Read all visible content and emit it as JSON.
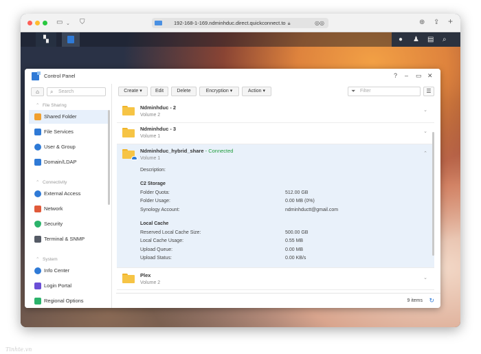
{
  "browser": {
    "url": "192-168-1-169.ndminhduc.direct.quickconnect.to"
  },
  "window": {
    "title": "Control Panel"
  },
  "sidebar": {
    "search_placeholder": "Search",
    "sections": [
      {
        "title": "File Sharing",
        "items": [
          {
            "label": "Shared Folder",
            "icon": "shared-folder-icon",
            "color": "#f0a030",
            "active": true
          },
          {
            "label": "File Services",
            "icon": "file-services-icon",
            "color": "#2f7ad6"
          },
          {
            "label": "User & Group",
            "icon": "user-group-icon",
            "color": "#2f7ad6"
          },
          {
            "label": "Domain/LDAP",
            "icon": "domain-ldap-icon",
            "color": "#2f7ad6"
          }
        ]
      },
      {
        "title": "Connectivity",
        "items": [
          {
            "label": "External Access",
            "icon": "external-access-icon",
            "color": "#2f7ad6"
          },
          {
            "label": "Network",
            "icon": "network-icon",
            "color": "#e05a3a"
          },
          {
            "label": "Security",
            "icon": "security-icon",
            "color": "#2bb36b"
          },
          {
            "label": "Terminal & SNMP",
            "icon": "terminal-icon",
            "color": "#555b66"
          }
        ]
      },
      {
        "title": "System",
        "items": [
          {
            "label": "Info Center",
            "icon": "info-center-icon",
            "color": "#2f7ad6"
          },
          {
            "label": "Login Portal",
            "icon": "login-portal-icon",
            "color": "#6b4fd6"
          },
          {
            "label": "Regional Options",
            "icon": "regional-options-icon",
            "color": "#2bb36b"
          }
        ]
      }
    ]
  },
  "toolbar": {
    "create": "Create",
    "edit": "Edit",
    "delete": "Delete",
    "encryption": "Encryption",
    "action": "Action",
    "filter_placeholder": "Filter"
  },
  "folders": [
    {
      "name": "Ndminhduc - 2",
      "volume": "Volume 2"
    },
    {
      "name": "Ndminhduc - 3",
      "volume": "Volume 1"
    },
    {
      "name": "Ndminhduc_hybrid_share",
      "status": "- Connected",
      "volume": "Volume 1",
      "description_label": "Description:",
      "c2": {
        "title": "C2 Storage",
        "rows": [
          {
            "label": "Folder Quota:",
            "value": "512.00 GB"
          },
          {
            "label": "Folder Usage:",
            "value": "0.00 MB (0%)"
          },
          {
            "label": "Synology Account:",
            "value": "ndminhductt@gmail.com"
          }
        ]
      },
      "cache": {
        "title": "Local Cache",
        "rows": [
          {
            "label": "Reserved Local Cache Size:",
            "value": "500.00 GB"
          },
          {
            "label": "Local Cache Usage:",
            "value": "0.55 MB"
          },
          {
            "label": "Upload Queue:",
            "value": "0.00 MB"
          },
          {
            "label": "Upload Status:",
            "value": "0.00 KB/s"
          }
        ]
      }
    },
    {
      "name": "Plex",
      "volume": "Volume 2"
    }
  ],
  "status_bar": {
    "items": "9 items"
  },
  "watermark": "Tinhte.vn"
}
